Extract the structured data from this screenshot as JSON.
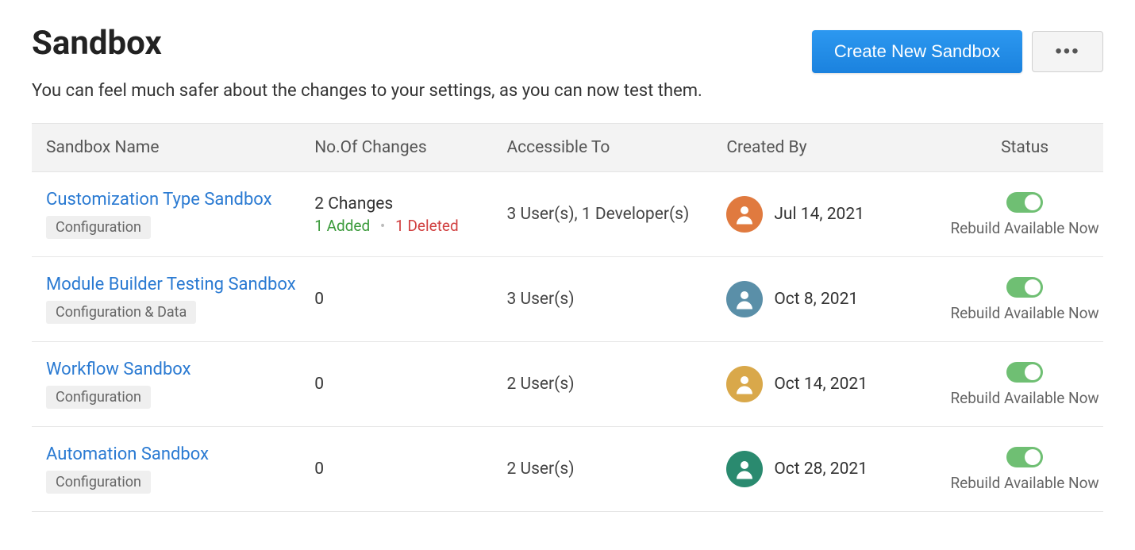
{
  "header": {
    "title": "Sandbox",
    "subtitle": "You can feel much safer about the changes to your settings, as you can now test them.",
    "create_label": "Create New Sandbox",
    "more_label": "•••"
  },
  "columns": {
    "name": "Sandbox Name",
    "changes": "No.Of Changes",
    "access": "Accessible To",
    "created": "Created By",
    "status": "Status"
  },
  "rows": [
    {
      "name": "Customization Type Sandbox",
      "type": "Configuration",
      "changes_main": "2 Changes",
      "added": "1 Added",
      "deleted": "1 Deleted",
      "access": "3 User(s), 1 Developer(s)",
      "avatar_color": "#e07a3f",
      "date": "Jul 14, 2021",
      "status_text": "Rebuild Available Now",
      "enabled": true
    },
    {
      "name": "Module Builder Testing Sandbox",
      "type": "Configuration & Data",
      "changes_main": "0",
      "added": "",
      "deleted": "",
      "access": "3 User(s)",
      "avatar_color": "#5a8fa8",
      "date": "Oct 8, 2021",
      "status_text": "Rebuild Available Now",
      "enabled": true
    },
    {
      "name": "Workflow Sandbox",
      "type": "Configuration",
      "changes_main": "0",
      "added": "",
      "deleted": "",
      "access": "2 User(s)",
      "avatar_color": "#d9a84a",
      "date": "Oct 14, 2021",
      "status_text": "Rebuild Available Now",
      "enabled": true
    },
    {
      "name": "Automation Sandbox",
      "type": "Configuration",
      "changes_main": "0",
      "added": "",
      "deleted": "",
      "access": "2 User(s)",
      "avatar_color": "#2a8a6f",
      "date": "Oct 28, 2021",
      "status_text": "Rebuild Available Now",
      "enabled": true
    }
  ]
}
